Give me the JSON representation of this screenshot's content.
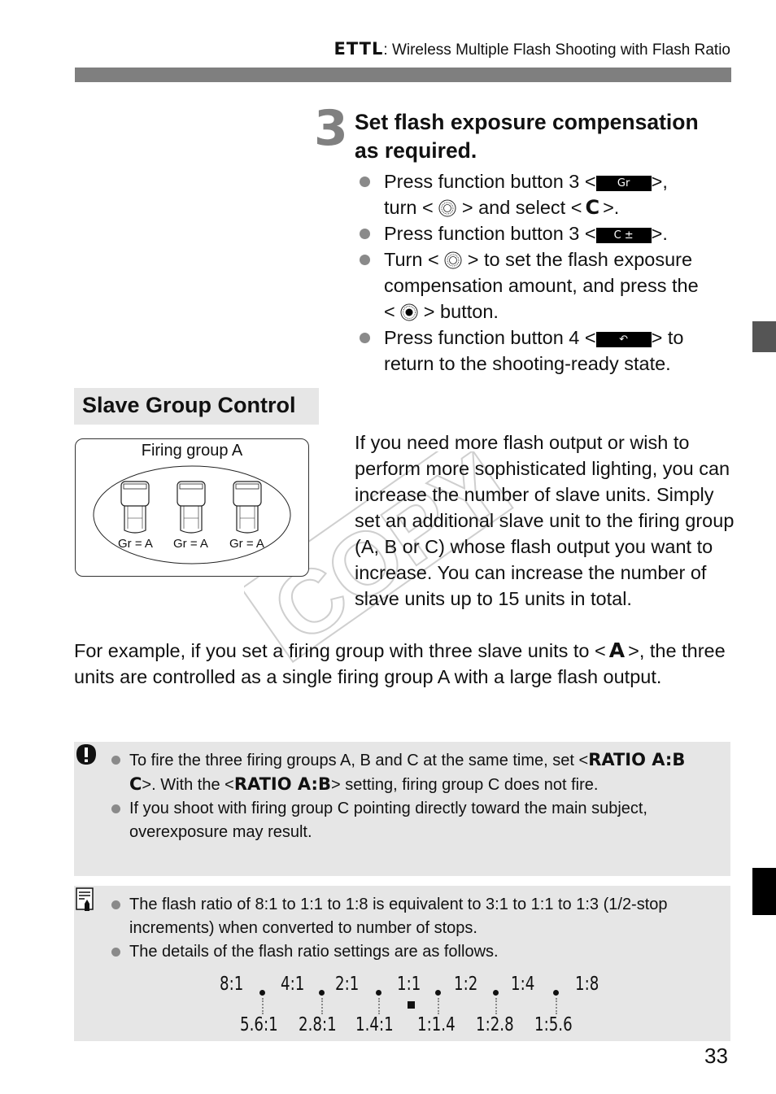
{
  "header": {
    "mode_label": "ETTL",
    "title": ": Wireless Multiple Flash Shooting with Flash Ratio"
  },
  "step": {
    "number": "3",
    "title_line1": "Set flash exposure compensation",
    "title_line2": "as required.",
    "bullets": [
      {
        "parts": [
          "Press function button 3 <",
          ">,",
          "turn <",
          "> and select <",
          ">."
        ],
        "key_label": "Gr",
        "select_label": "C"
      },
      {
        "parts": [
          "Press function button 3 <",
          ">."
        ],
        "key_label": "C ±"
      },
      {
        "parts": [
          "Turn <",
          "> to set the flash exposure compensation amount, and press the",
          "<",
          "> button."
        ]
      },
      {
        "parts": [
          "Press function button 4 <",
          "> to",
          "return to the shooting-ready state."
        ],
        "key_label": "↶"
      }
    ]
  },
  "section": {
    "heading": "Slave Group Control",
    "diagram": {
      "caption": "Firing group A",
      "units": [
        "Gr = A",
        "Gr = A",
        "Gr = A"
      ]
    },
    "paragraph": "If you need more flash output or wish to perform more sophisticated lighting, you can increase the number of slave units. Simply set an additional slave unit to the firing group (A, B or C) whose flash output you want to increase. You can increase the number of slave units up to 15 units in total.",
    "example_before": "For example, if you set a firing group with three slave units to <",
    "example_group": "A",
    "example_after": ">, the three units are controlled as a single firing group A with a large flash output."
  },
  "watermark": "COPY",
  "caution": {
    "icon": "caution-icon",
    "items": [
      {
        "t1": "To fire the three firing groups A, B and C at the same time, set <",
        "s1": "RATIO A:B C",
        "t2": ">. With the <",
        "s2": "RATIO A:B",
        "t3": "> setting, firing group C does not fire."
      },
      {
        "t1": "If you shoot with firing group C pointing directly toward the main subject, overexposure may result."
      }
    ]
  },
  "memo": {
    "icon": "memo-icon",
    "items": [
      "The flash ratio of 8:1 to 1:1 to 1:8 is equivalent to 3:1 to 1:1 to 1:3 (1/2-stop increments) when converted to number of stops.",
      "The details of the flash ratio settings are as follows."
    ],
    "ratio_scale": {
      "full_stops": [
        "8:1",
        "4:1",
        "2:1",
        "1:1",
        "1:2",
        "1:4",
        "1:8"
      ],
      "half_stops": [
        "5.6:1",
        "2.8:1",
        "1.4:1",
        "1:1.4",
        "1:2.8",
        "1:5.6"
      ],
      "center_marker": "1:1"
    }
  },
  "page_number": "33"
}
